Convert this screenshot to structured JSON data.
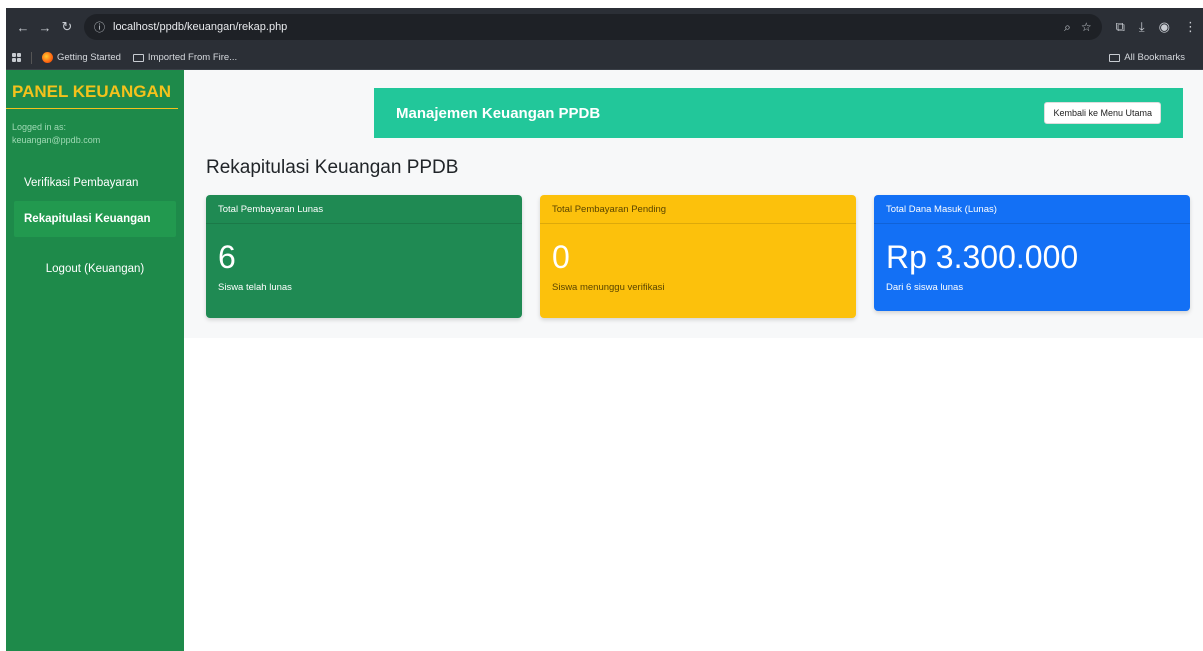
{
  "browser": {
    "url": "localhost/ppdb/keuangan/rekap.php",
    "bookmarks": [
      {
        "label": "Getting Started"
      },
      {
        "label": "Imported From Fire..."
      }
    ],
    "all_bookmarks": "All Bookmarks"
  },
  "sidebar": {
    "brand": "PANEL KEUANGAN",
    "logged_in_label": "Logged in as:",
    "logged_in_user": "keuangan@ppdb.com",
    "items": [
      {
        "label": "Verifikasi Pembayaran",
        "active": false
      },
      {
        "label": "Rekapitulasi Keuangan",
        "active": true
      }
    ],
    "logout": "Logout (Keuangan)"
  },
  "header": {
    "title": "Manajemen Keuangan PPDB",
    "back_button": "Kembali ke Menu Utama"
  },
  "main": {
    "page_title": "Rekapitulasi Keuangan PPDB",
    "cards": [
      {
        "title": "Total Pembayaran Lunas",
        "value": "6",
        "caption": "Siswa telah lunas",
        "color": "#1f8a53"
      },
      {
        "title": "Total Pembayaran Pending",
        "value": "0",
        "caption": "Siswa menunggu verifikasi",
        "color": "#fcc10c"
      },
      {
        "title": "Total Dana Masuk (Lunas)",
        "value": "Rp 3.300.000",
        "caption": "Dari 6 siswa lunas",
        "color": "#1370f5"
      }
    ]
  }
}
